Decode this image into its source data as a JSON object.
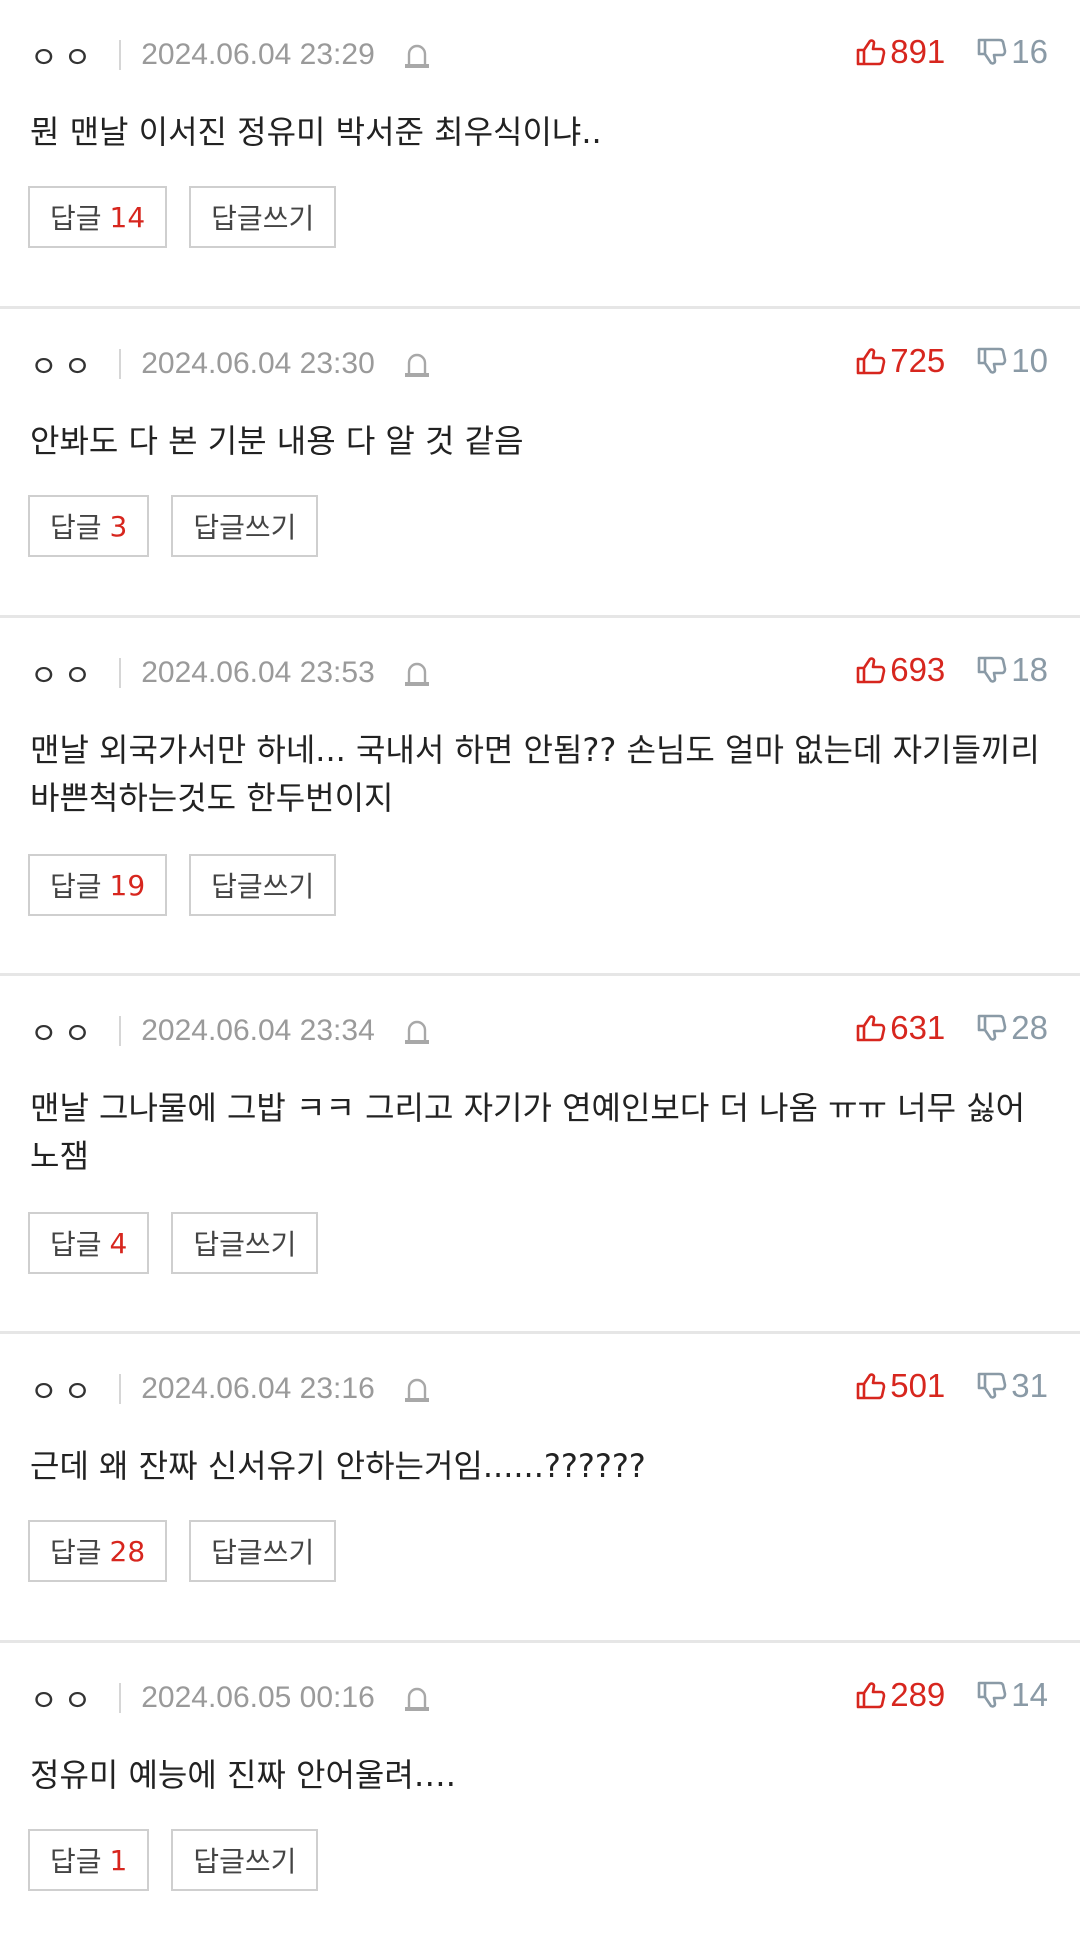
{
  "comments": [
    {
      "nickname": "ㅇㅇ",
      "date": "2024.06.04 23:29",
      "likes": "891",
      "dislikes": "16",
      "text": "뭔 맨날 이서진 정유미 박서준 최우식이냐..",
      "reply_label": "답글",
      "reply_count": "14",
      "write_reply_label": "답글쓰기"
    },
    {
      "nickname": "ㅇㅇ",
      "date": "2024.06.04 23:30",
      "likes": "725",
      "dislikes": "10",
      "text": "안봐도 다 본 기분 내용 다 알 것 같음",
      "reply_label": "답글",
      "reply_count": "3",
      "write_reply_label": "답글쓰기"
    },
    {
      "nickname": "ㅇㅇ",
      "date": "2024.06.04 23:53",
      "likes": "693",
      "dislikes": "18",
      "text": "맨날 외국가서만 하네... 국내서 하면 안됨?? 손님도 얼마 없는데 자기들끼리 바쁜척하는것도 한두번이지",
      "reply_label": "답글",
      "reply_count": "19",
      "write_reply_label": "답글쓰기"
    },
    {
      "nickname": "ㅇㅇ",
      "date": "2024.06.04 23:34",
      "likes": "631",
      "dislikes": "28",
      "text": "맨날 그나물에 그밥 ㅋㅋ 그리고 자기가 연예인보다 더 나옴 ㅠㅠ 너무 싫어 노잼",
      "reply_label": "답글",
      "reply_count": "4",
      "write_reply_label": "답글쓰기"
    },
    {
      "nickname": "ㅇㅇ",
      "date": "2024.06.04 23:16",
      "likes": "501",
      "dislikes": "31",
      "text": "근데 왜 잔짜 신서유기 안하는거임......??????",
      "reply_label": "답글",
      "reply_count": "28",
      "write_reply_label": "답글쓰기"
    },
    {
      "nickname": "ㅇㅇ",
      "date": "2024.06.05 00:16",
      "likes": "289",
      "dislikes": "14",
      "text": "정유미 예능에 진짜 안어울려….",
      "reply_label": "답글",
      "reply_count": "1",
      "write_reply_label": "답글쓰기"
    }
  ],
  "colors": {
    "like": "#d7261e",
    "dislike": "#8a9aa6",
    "date": "#9a9a9a",
    "divider": "#e6e6e6"
  },
  "icons": {
    "report": "siren-icon",
    "like": "thumbs-up-icon",
    "dislike": "thumbs-down-icon"
  }
}
